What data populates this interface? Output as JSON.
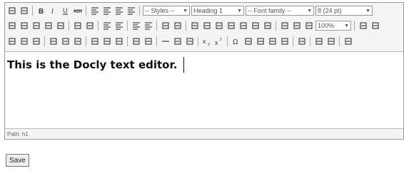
{
  "toolbar": {
    "row1_icons": [
      "save-icon",
      "new-document-icon",
      "sep",
      "bold-icon",
      "italic-icon",
      "underline-icon",
      "strikethrough-icon",
      "sep",
      "align-left-icon",
      "align-center-icon",
      "align-right-icon",
      "align-justify-icon"
    ],
    "styles_select": "-- Styles --",
    "format_select": "Heading 1",
    "font_family_select": "-- Font family --",
    "font_size_select": "8 (24 pt)",
    "row2_icons": [
      "cut-icon",
      "copy-icon",
      "paste-icon",
      "paste-text-icon",
      "paste-word-icon",
      "sep",
      "find-icon",
      "replace-icon",
      "sep",
      "bullet-list-icon",
      "numbered-list-icon",
      "sep",
      "outdent-icon",
      "indent-icon",
      "sep",
      "undo-icon",
      "redo-icon",
      "sep",
      "link-icon",
      "unlink-icon",
      "anchor-icon",
      "image-icon",
      "cleanup-icon",
      "help-icon",
      "code-icon",
      "sep",
      "insert-date-icon",
      "insert-time-icon",
      "preview-icon"
    ],
    "zoom_select": "100%",
    "row2_tail_icons": [
      "forecolor-icon",
      "backcolor-icon"
    ],
    "row3_icons": [
      "table-icon",
      "row-props-icon",
      "cell-props-icon",
      "sep",
      "insert-row-before-icon",
      "insert-row-after-icon",
      "delete-row-icon",
      "sep",
      "insert-col-before-icon",
      "insert-col-after-icon",
      "delete-col-icon",
      "sep",
      "split-cells-icon",
      "merge-cells-icon",
      "sep",
      "hr-icon",
      "remove-format-icon",
      "visual-aid-icon",
      "sep",
      "subscript-icon",
      "superscript-icon",
      "sep",
      "charmap-icon",
      "emotions-icon",
      "spellcheck-icon",
      "media-icon",
      "advhr-icon",
      "sep",
      "print-icon",
      "sep",
      "ltr-icon",
      "rtl-icon",
      "sep",
      "fullscreen-icon"
    ]
  },
  "editor": {
    "content": "This is the Docly text editor.",
    "status_path": "Path: h1"
  },
  "save_label": "Save"
}
